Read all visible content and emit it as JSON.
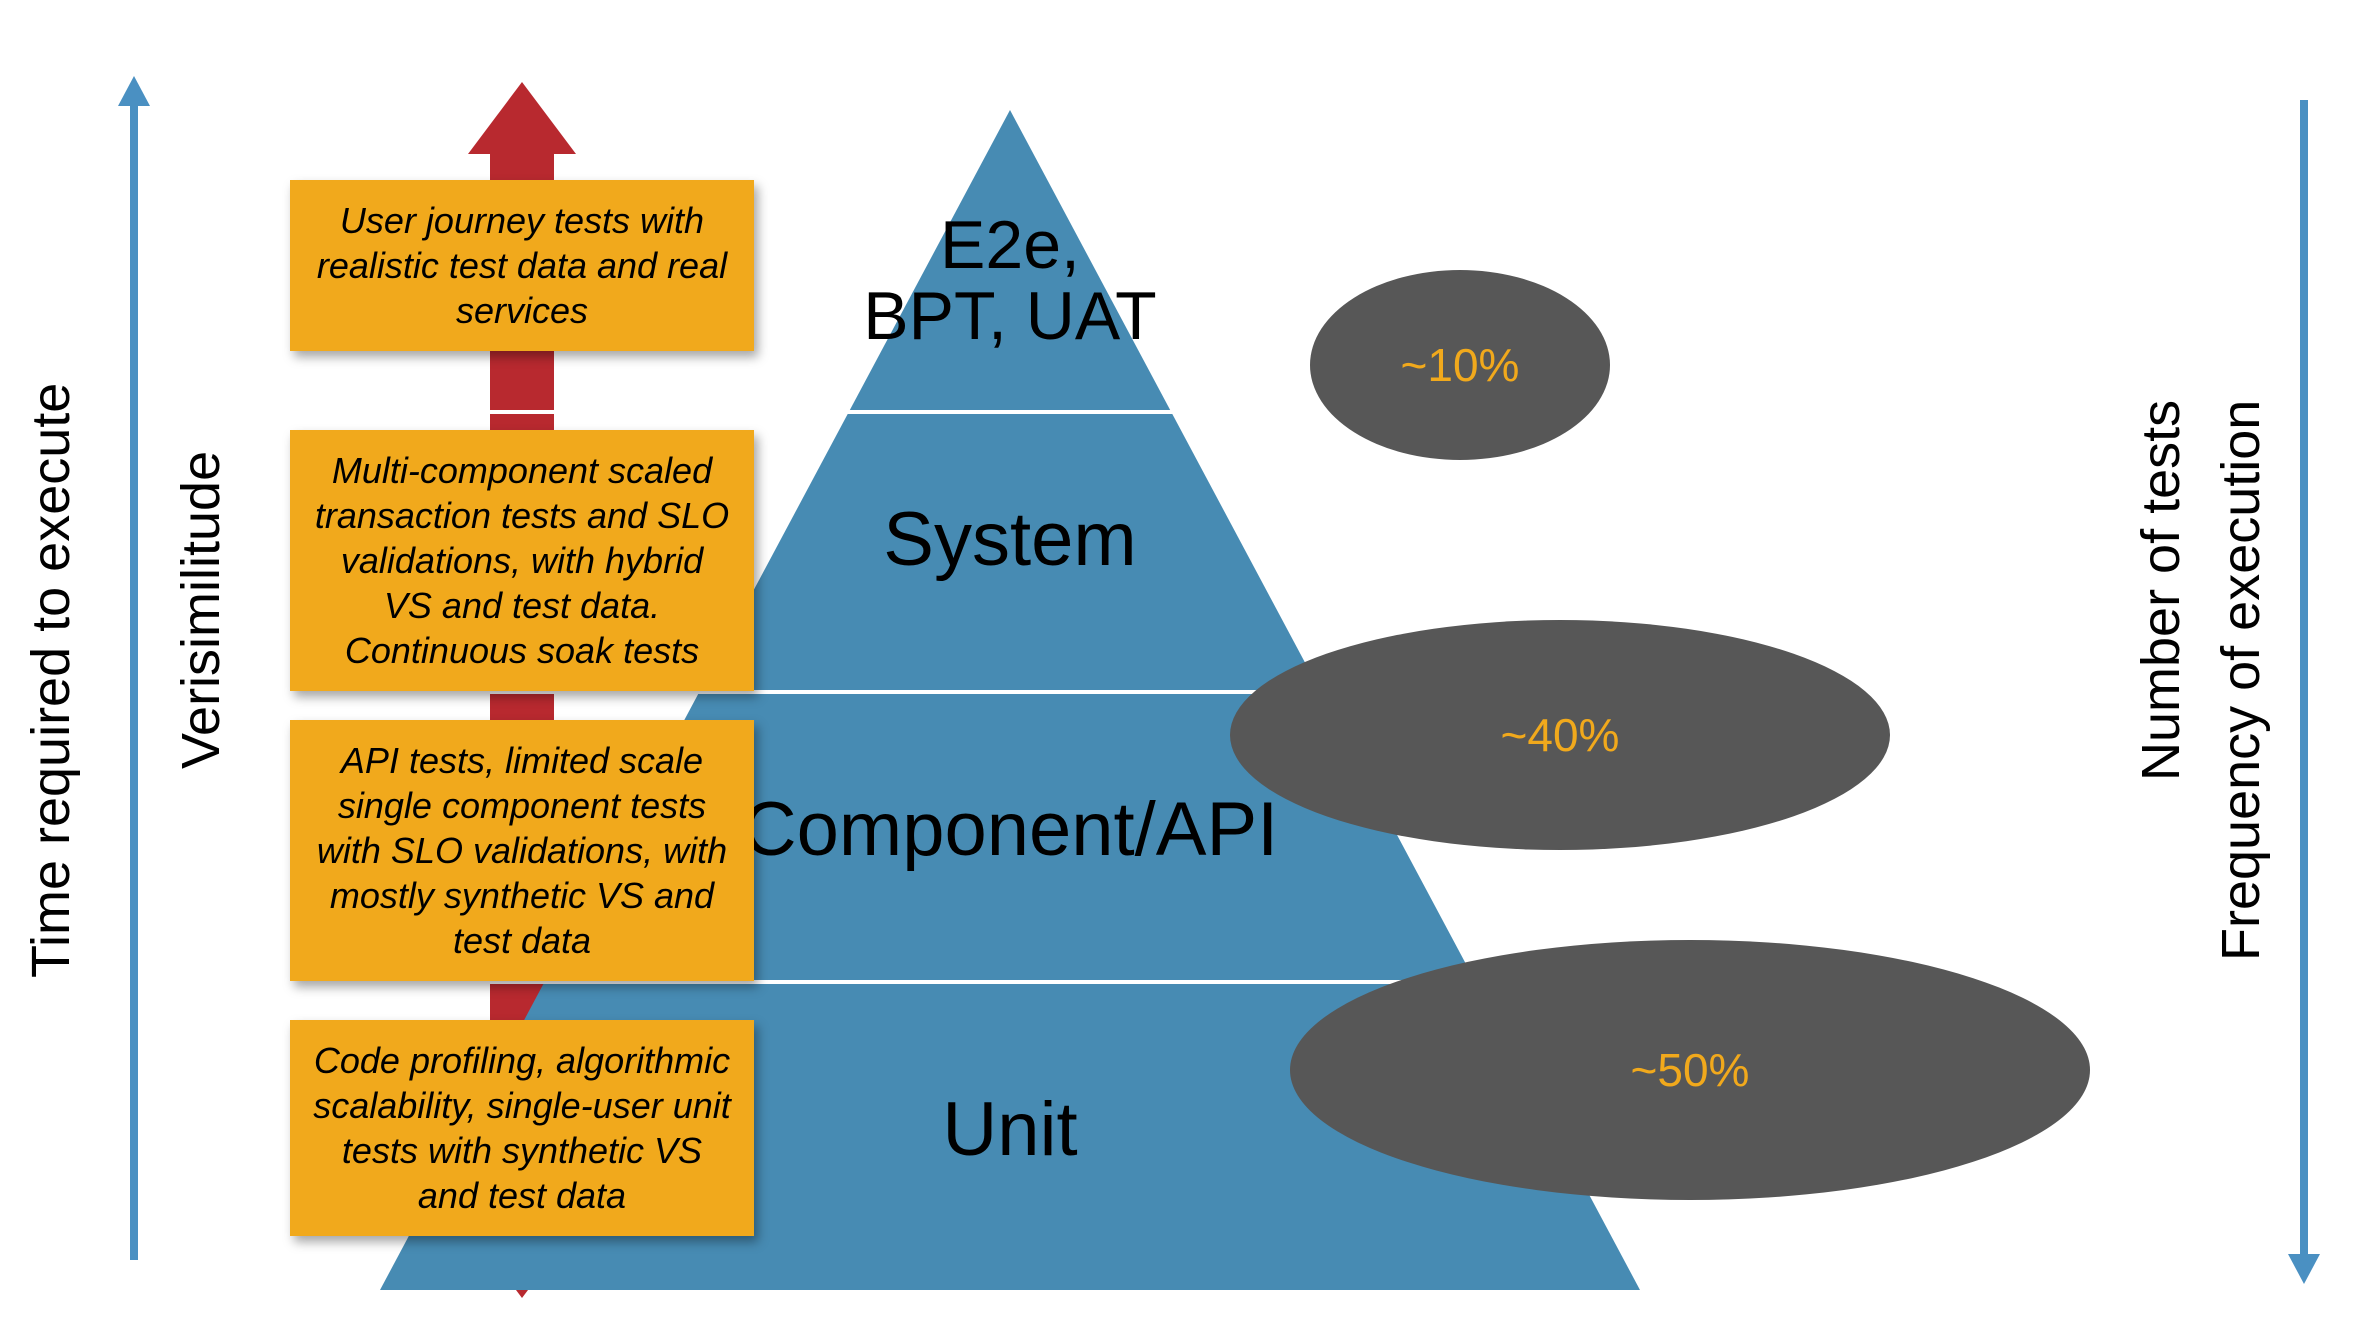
{
  "axes": {
    "time_label": "Time required to execute",
    "verisimilitude_label": "Verisimilitude",
    "tests_label": "Number of tests",
    "frequency_label": "Frequency of execution"
  },
  "tiers": {
    "top": "E2e,\nBPT, UAT",
    "system": "System",
    "component": "Component/API",
    "unit": "Unit"
  },
  "notes": {
    "n1": "User journey tests with realistic test data and real services",
    "n2": "Multi-component scaled transaction tests and SLO validations, with hybrid VS and test data. Continuous soak tests",
    "n3": "API tests, limited scale single component tests with SLO validations, with mostly synthetic VS and test data",
    "n4": "Code profiling, algorithmic scalability, single-user unit tests with synthetic VS and test data"
  },
  "bubbles": {
    "b1": "~10%",
    "b2": "~40%",
    "b3": "~50%"
  }
}
